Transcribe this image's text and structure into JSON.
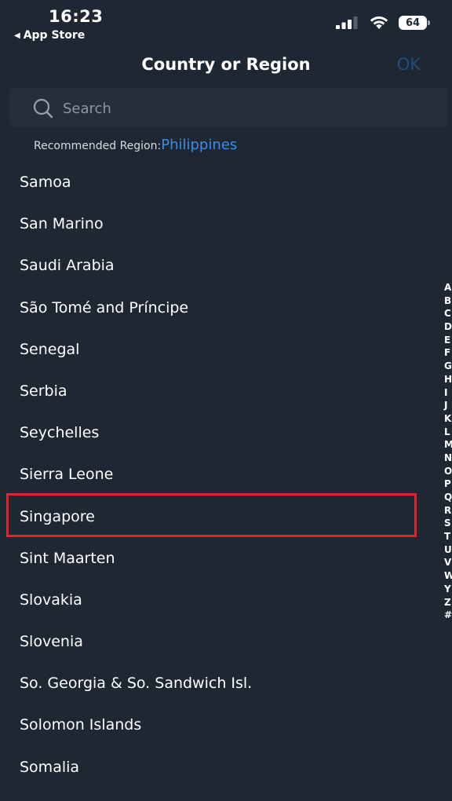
{
  "status_bar": {
    "time": "16:23",
    "back_label": "App Store",
    "battery": "64"
  },
  "nav": {
    "title": "Country or Region",
    "ok_label": "OK",
    "ok_color": "#1f4f80"
  },
  "search": {
    "placeholder": "Search"
  },
  "recommended": {
    "label": "Recommended Region:",
    "region": "Philippines",
    "link_color": "#3a8ee6"
  },
  "countries": [
    "Samoa",
    "San Marino",
    "Saudi Arabia",
    "São Tomé and Príncipe",
    "Senegal",
    "Serbia",
    "Seychelles",
    "Sierra Leone",
    "Singapore",
    "Sint Maarten",
    "Slovakia",
    "Slovenia",
    "So. Georgia & So. Sandwich Isl.",
    "Solomon Islands",
    "Somalia"
  ],
  "highlighted_country": "Singapore",
  "highlight_color": "#e0242d",
  "alphabet_index": [
    "A",
    "B",
    "C",
    "D",
    "E",
    "F",
    "G",
    "H",
    "I",
    "J",
    "K",
    "L",
    "M",
    "N",
    "O",
    "P",
    "Q",
    "R",
    "S",
    "T",
    "U",
    "V",
    "W",
    "Y",
    "Z",
    "#"
  ]
}
